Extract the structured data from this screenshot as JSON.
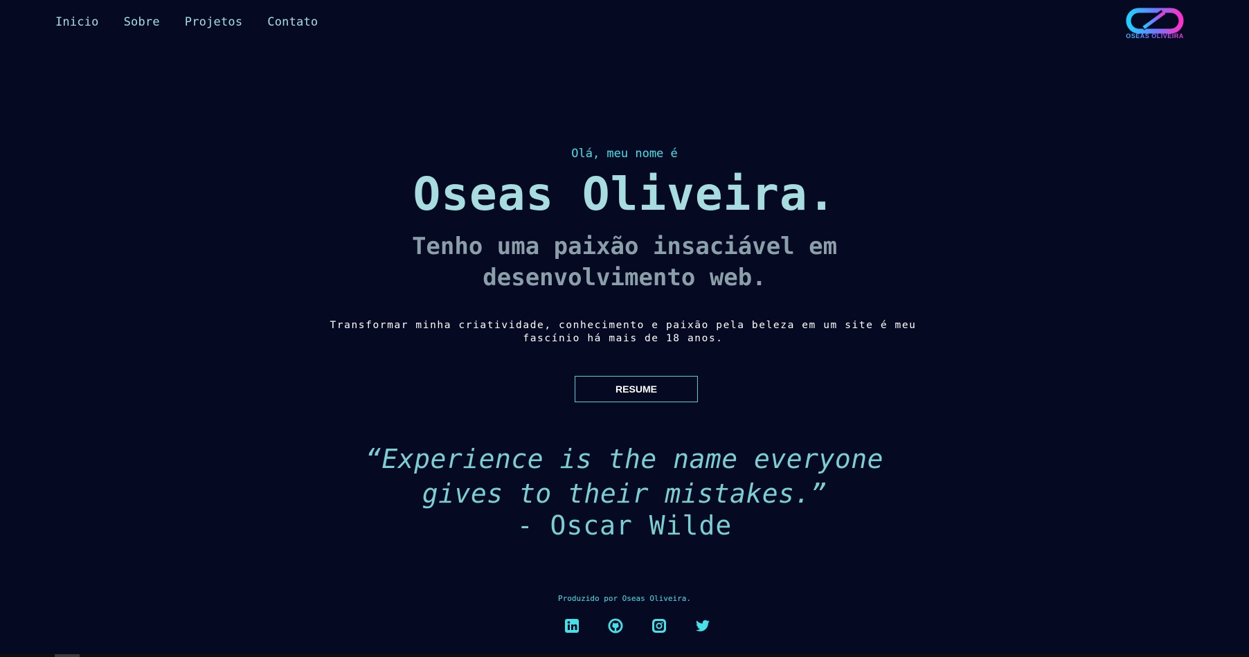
{
  "nav": {
    "items": [
      {
        "label": "Inicio"
      },
      {
        "label": "Sobre"
      },
      {
        "label": "Projetos"
      },
      {
        "label": "Contato"
      }
    ]
  },
  "logo": {
    "text": "OSEAS OLIVEIRA"
  },
  "hero": {
    "greeting": "Olá, meu nome é",
    "name": "Oseas Oliveira.",
    "tagline": "Tenho uma paixão insaciável em desenvolvimento web.",
    "description": "Transformar minha criatividade, conhecimento e paixão pela beleza em um site é meu fascínio há mais de 18 anos.",
    "resume_label": "RESUME"
  },
  "quote": {
    "text": "“Experience is the name everyone gives to their mistakes.”",
    "author": "- Oscar Wilde"
  },
  "footer": {
    "credit": "Produzido por Oseas Oliveira.",
    "social": [
      {
        "icon": "linkedin-icon"
      },
      {
        "icon": "github-icon"
      },
      {
        "icon": "instagram-icon"
      },
      {
        "icon": "twitter-icon"
      }
    ]
  },
  "colors": {
    "background": "#050a22",
    "accent": "#46e0e8",
    "primary_text": "#a7dde0"
  }
}
